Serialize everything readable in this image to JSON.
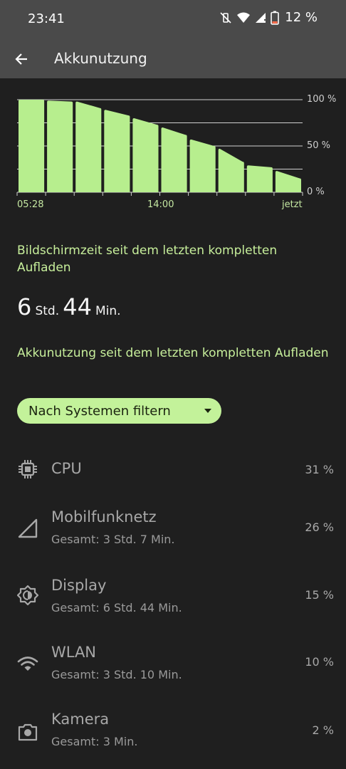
{
  "status_bar": {
    "time": "23:41",
    "battery_text": "12 %"
  },
  "app_bar": {
    "title": "Akkunutzung"
  },
  "chart_data": {
    "type": "bar",
    "x_tick_labels": [
      "05:28",
      "14:00",
      "jetzt"
    ],
    "y_tick_labels": [
      "100 %",
      "50 %",
      "0 %"
    ],
    "ylim": [
      0,
      100
    ],
    "bars": [
      {
        "start": 100,
        "end": 100
      },
      {
        "start": 99,
        "end": 98
      },
      {
        "start": 98,
        "end": 91
      },
      {
        "start": 89,
        "end": 83
      },
      {
        "start": 80,
        "end": 73
      },
      {
        "start": 70,
        "end": 62
      },
      {
        "start": 57,
        "end": 50
      },
      {
        "start": 47,
        "end": 33
      },
      {
        "start": 29,
        "end": 27
      },
      {
        "start": 23,
        "end": 15
      }
    ],
    "bar_color": "#b7ee8e"
  },
  "screen_time": {
    "title": "Bildschirmzeit seit dem letzten kompletten Aufladen",
    "hours": "6",
    "hours_unit": "Std.",
    "minutes": "44",
    "minutes_unit": "Min."
  },
  "usage": {
    "title": "Akkunutzung seit dem letzten kompletten Aufladen",
    "filter_label": "Nach Systemen filtern",
    "items": [
      {
        "icon": "cpu-icon",
        "name": "CPU",
        "sub": "",
        "percent": "31 %"
      },
      {
        "icon": "cellular-icon",
        "name": "Mobilfunknetz",
        "sub": "Gesamt: 3 Std. 7 Min.",
        "percent": "26 %"
      },
      {
        "icon": "display-icon",
        "name": "Display",
        "sub": "Gesamt: 6 Std. 44 Min.",
        "percent": "15 %"
      },
      {
        "icon": "wifi-icon",
        "name": "WLAN",
        "sub": "Gesamt: 3 Std. 10 Min.",
        "percent": "10 %"
      },
      {
        "icon": "camera-icon",
        "name": "Kamera",
        "sub": "Gesamt: 3 Min.",
        "percent": "2 %"
      }
    ]
  },
  "colors": {
    "accent": "#c3f29a",
    "background": "#1f1f1f",
    "app_bar": "#4a4a4a"
  }
}
